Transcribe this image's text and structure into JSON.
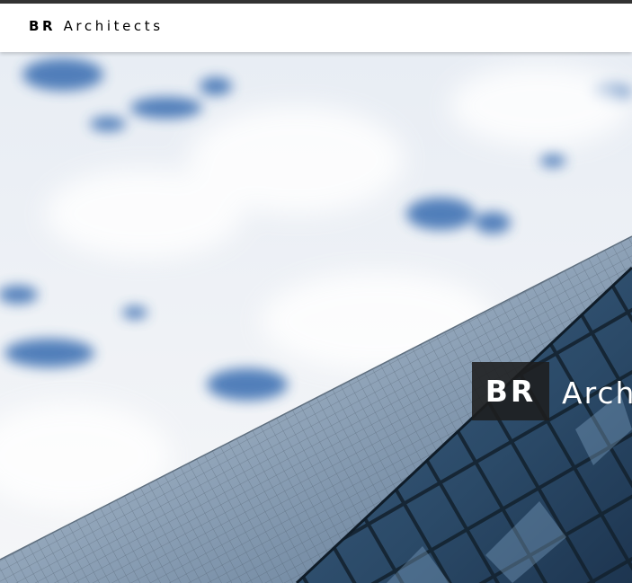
{
  "navbar": {
    "brand_bold": "BR",
    "brand_light": "Architects"
  },
  "hero": {
    "logo_box": "BR",
    "logo_text": "Architects",
    "image_description_icon": "sky-building-photo"
  },
  "colors": {
    "topline": "#333333",
    "navbar_bg": "#ffffff",
    "sky": "#f2f4f7",
    "cloud_blue": "#3d6fb0",
    "glass_dark": "#2b4a68"
  }
}
